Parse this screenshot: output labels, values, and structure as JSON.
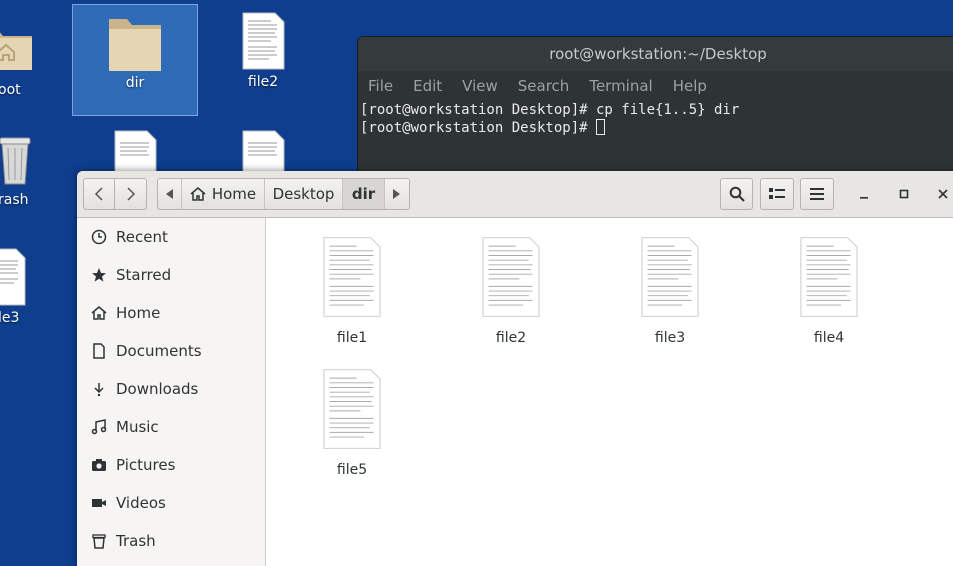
{
  "desktop": {
    "icons": [
      {
        "label": "oot"
      },
      {
        "label": "dir"
      },
      {
        "label": "file2"
      },
      {
        "label": "rash"
      },
      {
        "label": "le3"
      }
    ]
  },
  "terminal": {
    "title": "root@workstation:~/Desktop",
    "menu": [
      "File",
      "Edit",
      "View",
      "Search",
      "Terminal",
      "Help"
    ],
    "lines": [
      "[root@workstation Desktop]# cp file{1..5} dir",
      "[root@workstation Desktop]# "
    ]
  },
  "files": {
    "path": [
      "Home",
      "Desktop",
      "dir"
    ],
    "sidebar": [
      {
        "label": "Recent",
        "icon": "clock-icon"
      },
      {
        "label": "Starred",
        "icon": "star-icon"
      },
      {
        "label": "Home",
        "icon": "home-icon"
      },
      {
        "label": "Documents",
        "icon": "document-icon"
      },
      {
        "label": "Downloads",
        "icon": "download-icon"
      },
      {
        "label": "Music",
        "icon": "music-icon"
      },
      {
        "label": "Pictures",
        "icon": "camera-icon"
      },
      {
        "label": "Videos",
        "icon": "video-icon"
      },
      {
        "label": "Trash",
        "icon": "trash-icon"
      }
    ],
    "items": [
      "file1",
      "file2",
      "file3",
      "file4",
      "file5"
    ]
  }
}
